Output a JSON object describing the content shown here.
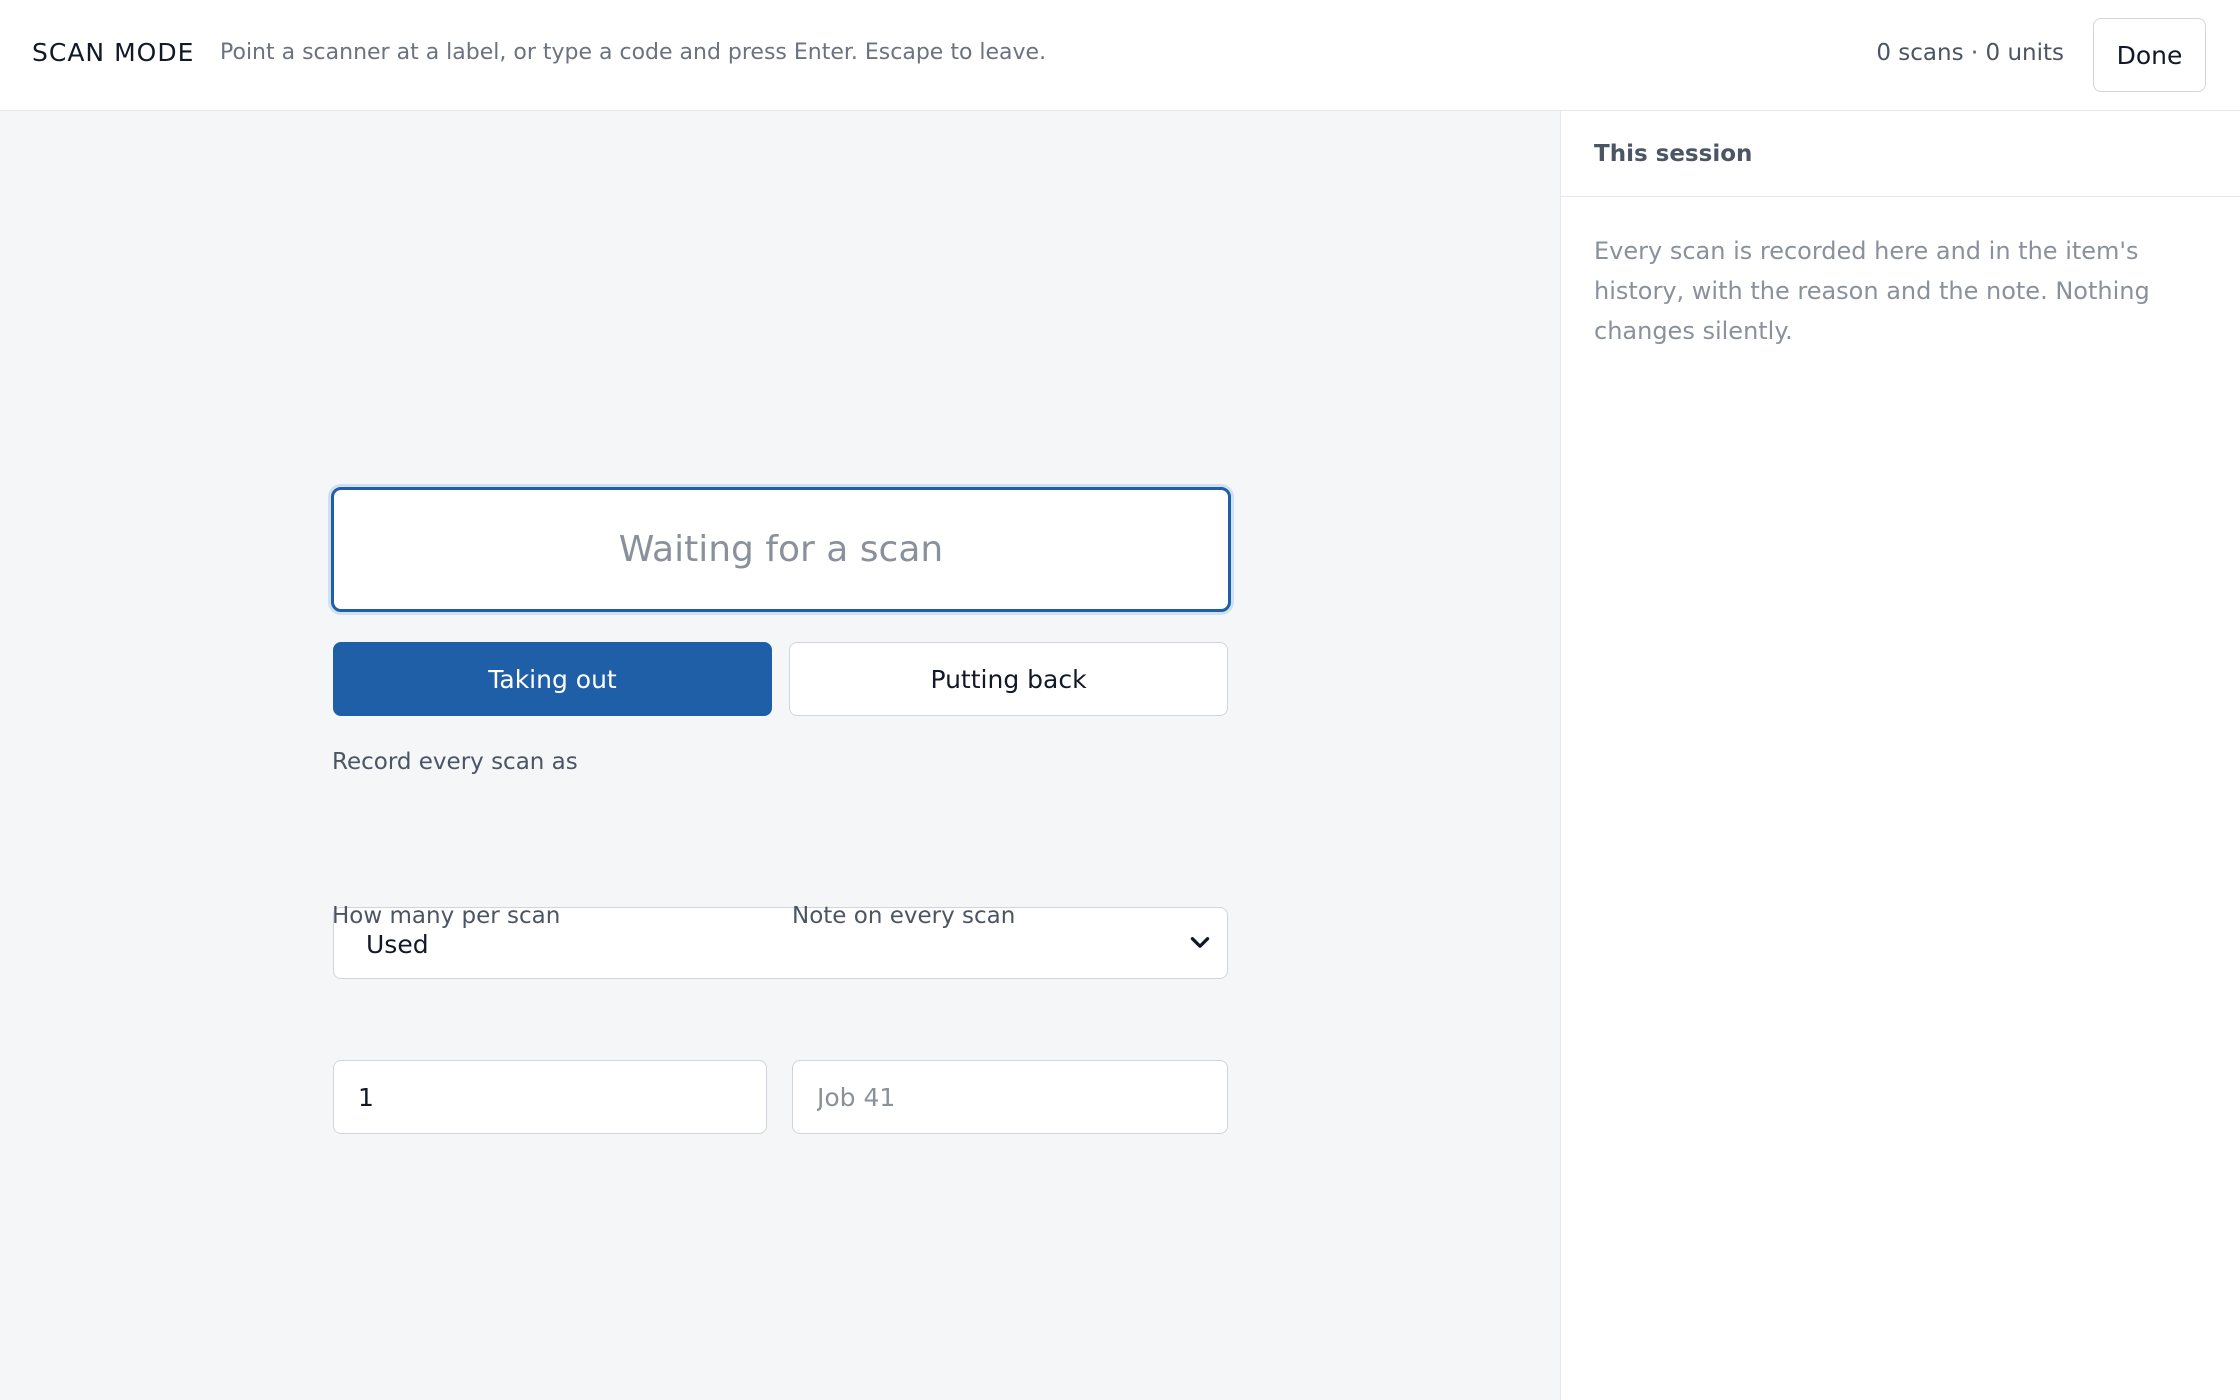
{
  "header": {
    "title": "SCAN MODE",
    "hint": "Point a scanner at a label, or type a code and press Enter. Escape to leave.",
    "counts": "0 scans · 0 units",
    "done_label": "Done"
  },
  "scan": {
    "placeholder": "Waiting for a scan",
    "value": ""
  },
  "modes": {
    "taking_out": "Taking out",
    "putting_back": "Putting back",
    "selected": "Taking out"
  },
  "record": {
    "label": "Record every scan as",
    "selected": "Used"
  },
  "quantity": {
    "label": "How many per scan",
    "value": "1"
  },
  "note": {
    "label": "Note on every scan",
    "placeholder": "Job 41",
    "value": ""
  },
  "session": {
    "title": "This session",
    "empty_text": "Every scan is recorded here and in the item's history, with the reason and the note. Nothing changes silently."
  },
  "colors": {
    "accent": "#1e5fa8",
    "background": "#f5f6f8",
    "muted_text": "#8a919c"
  },
  "icons": {
    "select_chevron": "chevron-down-icon"
  }
}
